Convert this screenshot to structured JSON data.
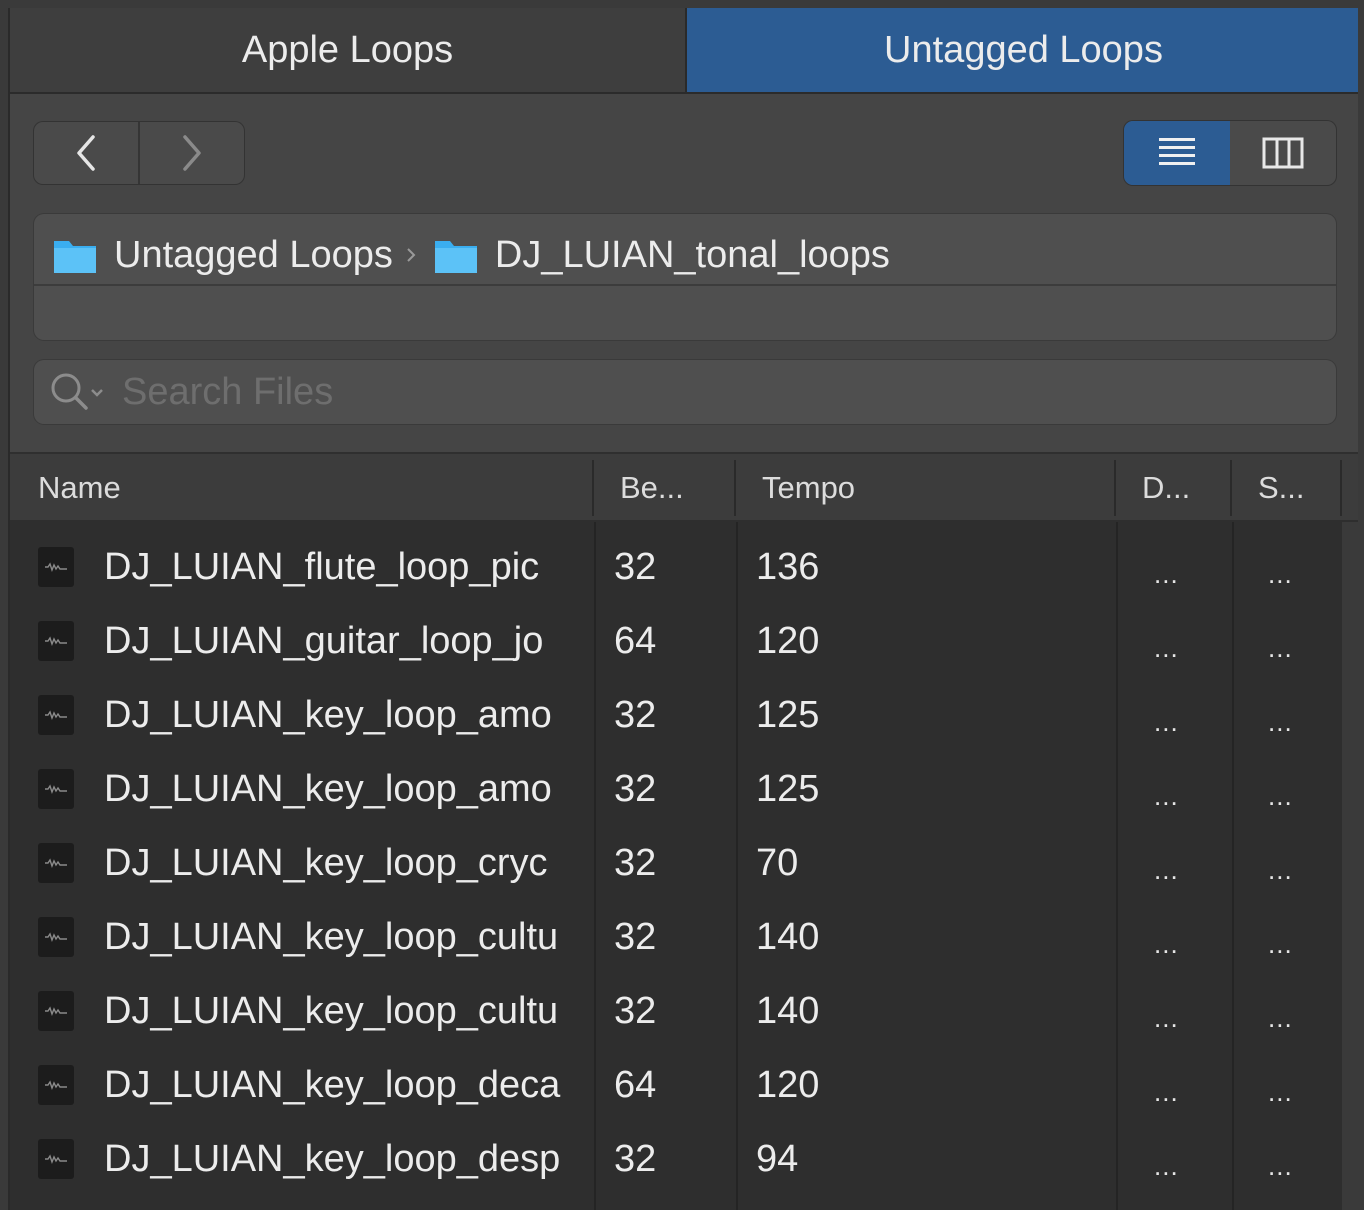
{
  "tabs": [
    {
      "label": "Apple Loops",
      "active": false
    },
    {
      "label": "Untagged Loops",
      "active": true
    }
  ],
  "nav": {
    "back_icon": "chevron-left-icon",
    "forward_icon": "chevron-right-icon"
  },
  "views": {
    "list_icon": "list-view-icon",
    "column_icon": "column-view-icon",
    "selected": "list"
  },
  "path": {
    "segments": [
      "Untagged Loops",
      "DJ_LUIAN_tonal_loops"
    ]
  },
  "search": {
    "placeholder": "Search Files",
    "value": ""
  },
  "columns": {
    "name": "Name",
    "beats": "Be...",
    "tempo": "Tempo",
    "d": "D...",
    "s": "S..."
  },
  "rows": [
    {
      "name": "DJ_LUIAN_flute_loop_pic",
      "beats": "32",
      "tempo": "136",
      "d": "...",
      "s": "..."
    },
    {
      "name": "DJ_LUIAN_guitar_loop_jo",
      "beats": "64",
      "tempo": "120",
      "d": "...",
      "s": "..."
    },
    {
      "name": "DJ_LUIAN_key_loop_amo",
      "beats": "32",
      "tempo": "125",
      "d": "...",
      "s": "..."
    },
    {
      "name": "DJ_LUIAN_key_loop_amo",
      "beats": "32",
      "tempo": "125",
      "d": "...",
      "s": "..."
    },
    {
      "name": "DJ_LUIAN_key_loop_cryc",
      "beats": "32",
      "tempo": "70",
      "d": "...",
      "s": "..."
    },
    {
      "name": "DJ_LUIAN_key_loop_cultu",
      "beats": "32",
      "tempo": "140",
      "d": "...",
      "s": "..."
    },
    {
      "name": "DJ_LUIAN_key_loop_cultu",
      "beats": "32",
      "tempo": "140",
      "d": "...",
      "s": "..."
    },
    {
      "name": "DJ_LUIAN_key_loop_deca",
      "beats": "64",
      "tempo": "120",
      "d": "...",
      "s": "..."
    },
    {
      "name": "DJ_LUIAN_key_loop_desp",
      "beats": "32",
      "tempo": "94",
      "d": "...",
      "s": "..."
    }
  ],
  "colors": {
    "accent": "#2c5c93",
    "panel": "#454545",
    "list_bg": "#2e2e2e"
  }
}
